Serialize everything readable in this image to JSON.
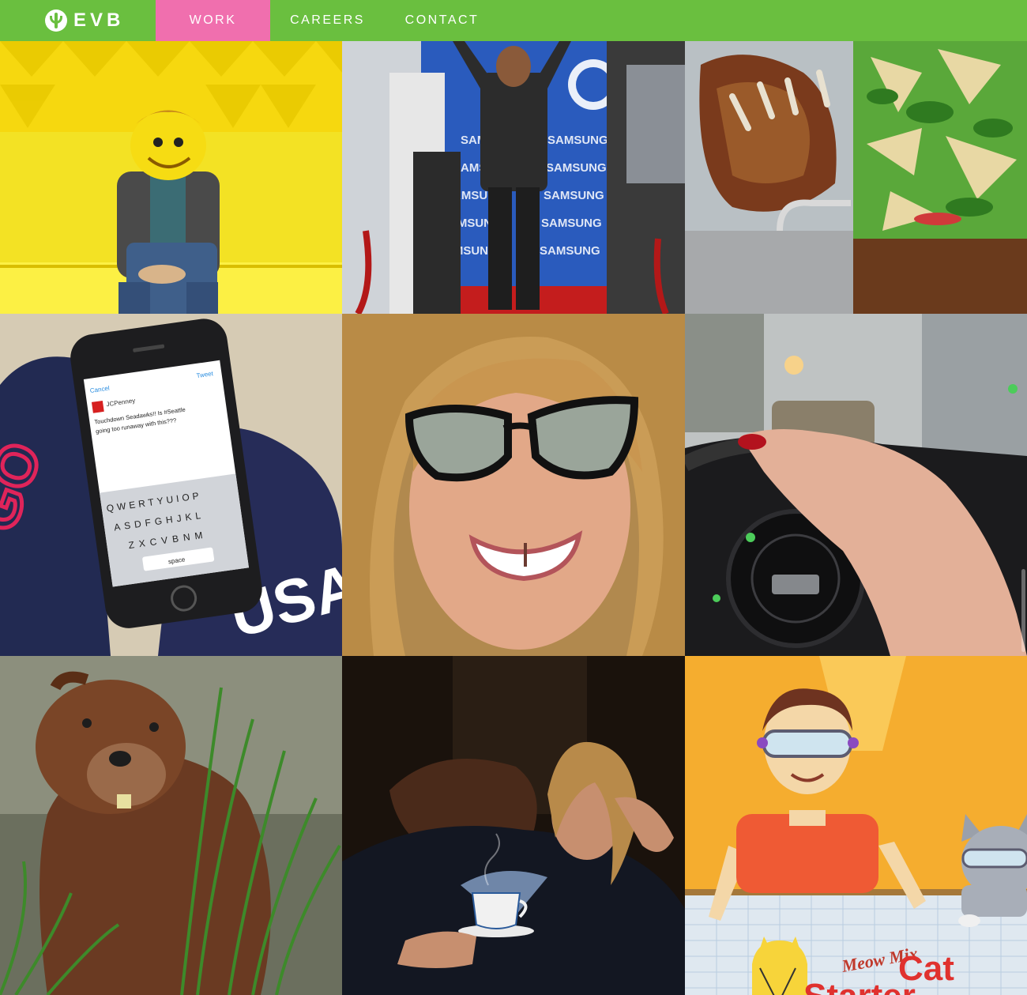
{
  "nav": {
    "logo_text": "EVB",
    "items": [
      {
        "label": "WORK",
        "active": true
      },
      {
        "label": "CAREERS",
        "active": false
      },
      {
        "label": "CONTACT",
        "active": false
      }
    ]
  },
  "colors": {
    "nav_background": "#6abf3f",
    "active_nav": "#f06fae"
  },
  "tiles": {
    "samsung_backdrop": "SAMSUNG",
    "phone_cancel": "Cancel",
    "phone_tweet": "Tweet",
    "phone_handle": "JCPenney",
    "phone_text_1": "Touchdown Seadawks!! Is #Seattle",
    "phone_text_2": "going too runaway with this???",
    "keyboard_row1": "QWERTYUIOP",
    "keyboard_row2": "ASDFGHJKL",
    "keyboard_row3": "ZXCVBNM",
    "keyboard_space": "space",
    "mitten_left": "GO",
    "mitten_right": "USA",
    "meow_mix": "Meow Mix",
    "cat_word": "Cat",
    "starter_word": "Starter"
  }
}
